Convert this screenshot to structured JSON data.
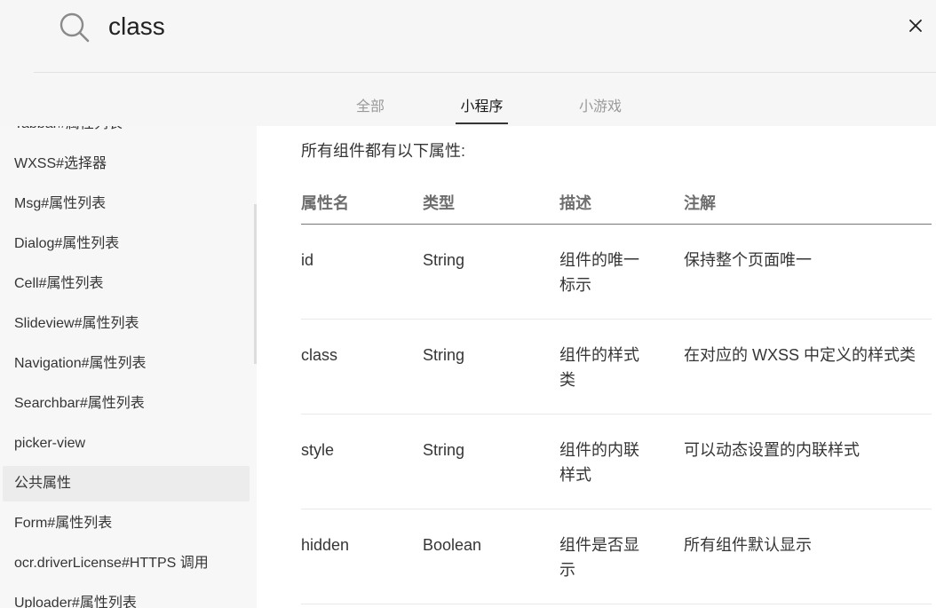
{
  "search": {
    "query": "class",
    "tabs": [
      {
        "label": "全部",
        "active": false
      },
      {
        "label": "小程序",
        "active": true
      },
      {
        "label": "小游戏",
        "active": false
      }
    ]
  },
  "sidebar": {
    "items": [
      {
        "label": "Tabbar#属性列表"
      },
      {
        "label": "WXSS#选择器"
      },
      {
        "label": "Msg#属性列表"
      },
      {
        "label": "Dialog#属性列表"
      },
      {
        "label": "Cell#属性列表"
      },
      {
        "label": "Slideview#属性列表"
      },
      {
        "label": "Navigation#属性列表"
      },
      {
        "label": "Searchbar#属性列表"
      },
      {
        "label": "picker-view"
      },
      {
        "label": "公共属性",
        "active": true
      },
      {
        "label": "Form#属性列表"
      },
      {
        "label": "ocr.driverLicense#HTTPS 调用"
      },
      {
        "label": "Uploader#属性列表"
      }
    ]
  },
  "content": {
    "intro": "所有组件都有以下属性:",
    "table": {
      "headers": [
        "属性名",
        "类型",
        "描述",
        "注解"
      ],
      "rows": [
        {
          "name": "id",
          "type": "String",
          "desc": "组件的唯一标示",
          "note": "保持整个页面唯一"
        },
        {
          "name": "class",
          "type": "String",
          "desc": "组件的样式类",
          "note": "在对应的 WXSS 中定义的样式类"
        },
        {
          "name": "style",
          "type": "String",
          "desc": "组件的内联样式",
          "note": "可以动态设置的内联样式"
        },
        {
          "name": "hidden",
          "type": "Boolean",
          "desc": "组件是否显示",
          "note": "所有组件默认显示"
        }
      ]
    }
  },
  "icons": {
    "search": "search-icon",
    "close": "close-icon"
  },
  "colors": {
    "header_bg": "#f6f6f6",
    "sidebar_bg": "#f7f7f7",
    "active_item_bg": "#ececec"
  }
}
